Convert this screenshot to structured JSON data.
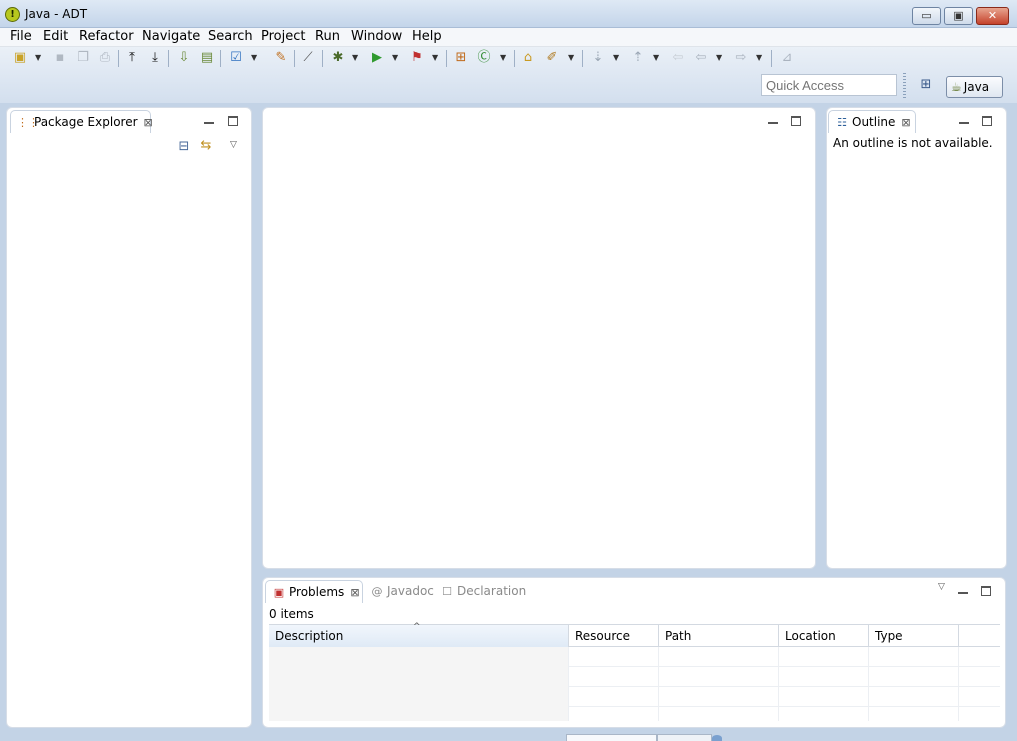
{
  "window": {
    "title": "Java - ADT",
    "minimize": "▭",
    "maximize": "▣",
    "close": "✕"
  },
  "menu": [
    {
      "label": "File"
    },
    {
      "label": "Edit"
    },
    {
      "label": "Refactor"
    },
    {
      "label": "Navigate"
    },
    {
      "label": "Search"
    },
    {
      "label": "Project"
    },
    {
      "label": "Run"
    },
    {
      "label": "Window"
    },
    {
      "label": "Help"
    }
  ],
  "toolbar": {
    "quick_access_placeholder": "Quick Access",
    "perspective": "Java"
  },
  "package_explorer": {
    "tab_label": "Package Explorer"
  },
  "outline": {
    "tab_label": "Outline",
    "message": "An outline is not available."
  },
  "problems": {
    "tabs": [
      {
        "label": "Problems"
      },
      {
        "label": "Javadoc"
      },
      {
        "label": "Declaration"
      }
    ],
    "item_count": "0 items",
    "columns": [
      "Description",
      "Resource",
      "Path",
      "Location",
      "Type"
    ]
  },
  "colors": {
    "accent": "#c3d3e6",
    "panel_bg": "#ffffff",
    "close_red": "#c5422b"
  }
}
